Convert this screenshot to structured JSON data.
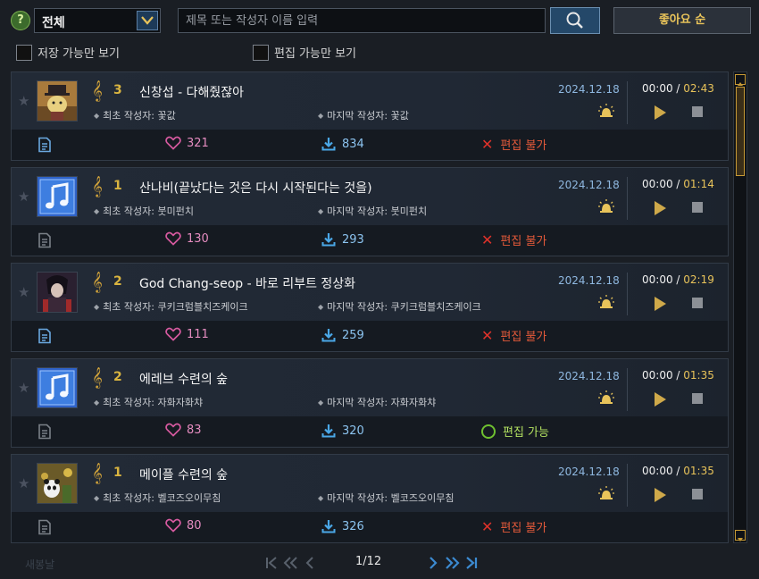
{
  "filter": {
    "help_icon": "?",
    "category": "전체",
    "search_placeholder": "제목 또는 작성자 이름 입력",
    "sort_label": "좋아요 순",
    "save_only_label": "저장 가능만 보기",
    "edit_only_label": "편집 가능만 보기"
  },
  "labels": {
    "first_author_prefix": "최초 작성자:",
    "last_author_prefix": "마지막 작성자:"
  },
  "songs": [
    {
      "count": "3",
      "title": "신창섭 - 다해줬잖아",
      "first_author": "꽃값",
      "last_author": "꽃값",
      "date": "2024.12.18",
      "current": "00:00",
      "total": "02:43",
      "likes": "321",
      "downloads": "834",
      "edit_label": "편집 불가",
      "editable": false,
      "doc_active": true,
      "thumb": "character-hat"
    },
    {
      "count": "1",
      "title": "산나비(끝났다는 것은 다시 시작된다는 것을)",
      "first_author": "붓미펀치",
      "last_author": "붓미펀치",
      "date": "2024.12.18",
      "current": "00:00",
      "total": "01:14",
      "likes": "130",
      "downloads": "293",
      "edit_label": "편집 불가",
      "editable": false,
      "doc_active": false,
      "thumb": "music-note"
    },
    {
      "count": "2",
      "title": "God Chang-seop - 바로 리부트 정상화",
      "first_author": "쿠키크럼블치즈케이크",
      "last_author": "쿠키크럼블치즈케이크",
      "date": "2024.12.18",
      "current": "00:00",
      "total": "02:19",
      "likes": "111",
      "downloads": "259",
      "edit_label": "편집 불가",
      "editable": false,
      "doc_active": true,
      "thumb": "character-dark"
    },
    {
      "count": "2",
      "title": "에레브 수련의 숲",
      "first_author": "자화자화챠",
      "last_author": "자화자화챠",
      "date": "2024.12.18",
      "current": "00:00",
      "total": "01:35",
      "likes": "83",
      "downloads": "320",
      "edit_label": "편집 가능",
      "editable": true,
      "doc_active": false,
      "thumb": "music-note"
    },
    {
      "count": "1",
      "title": "메이플 수련의 숲",
      "first_author": "벨코즈오이무침",
      "last_author": "벨코즈오이무침",
      "date": "2024.12.18",
      "current": "00:00",
      "total": "01:35",
      "likes": "80",
      "downloads": "326",
      "edit_label": "편집 불가",
      "editable": false,
      "doc_active": false,
      "thumb": "character-panda"
    }
  ],
  "pager": {
    "page": "1/12",
    "footnote": "새봉날"
  },
  "colors": {
    "accent_gold": "#e8c35a",
    "date_blue": "#8fb8e0",
    "like_pink": "#e58cc0",
    "download_blue": "#8cc4f0",
    "not_editable_red": "#e45a3a",
    "editable_green": "#b2e060"
  }
}
